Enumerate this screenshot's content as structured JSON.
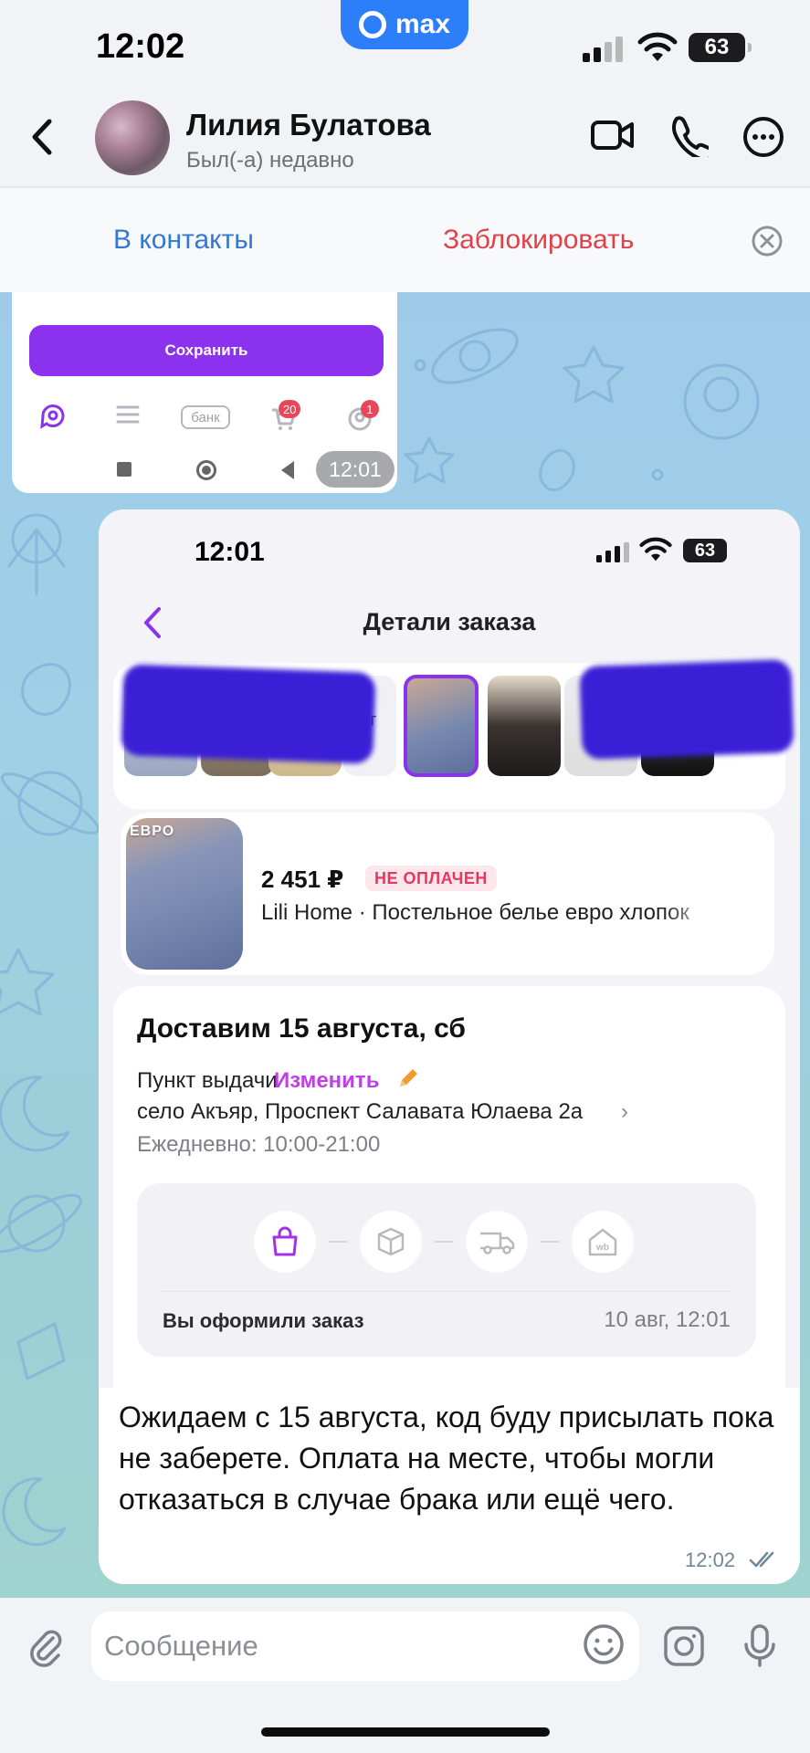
{
  "status_bar": {
    "time": "12:02",
    "battery": "63",
    "app_badge": "max"
  },
  "chat_header": {
    "contact_name": "Лилия Булатова",
    "contact_status": "Был(-а) недавно"
  },
  "contact_actions": {
    "add_label": "В контакты",
    "block_label": "Заблокировать"
  },
  "message_1": {
    "save_button": "Сохранить",
    "nav_bank_label": "банк",
    "cart_badge": "20",
    "profile_badge": "1",
    "time": "12:01"
  },
  "message_2": {
    "screenshot": {
      "status_time": "12:01",
      "battery": "63",
      "title": "Детали заказа",
      "date_chip": {
        "day": "15",
        "month": "авг",
        "weekday": "сб"
      },
      "order_item": {
        "image_tag": "ЕВРО",
        "price": "2 451 ₽",
        "payment_status": "НЕ ОПЛАЧЕН",
        "title": "Lili Home · Постельное белье евро хлопок"
      },
      "delivery": {
        "title": "Доставим 15 августа, сб",
        "pickup_label": "Пункт выдачи",
        "change_label": "Изменить",
        "address": "село Акъяр, Проспект Салавата Юлаева 2а",
        "hours": "Ежедневно: 10:00-21:00"
      },
      "progress": {
        "current_step": 1,
        "total_steps": 4,
        "status_text": "Вы оформили заказ",
        "status_date": "10 авг, 12:01"
      }
    },
    "text": "Ожидаем с 15 августа, код буду присылать пока не заберете. Оплата на месте, чтобы могли отказаться в случае брака или ещё чего.",
    "time": "12:02",
    "read": true
  },
  "input_bar": {
    "placeholder": "Сообщение"
  },
  "colors": {
    "accent_blue": "#3478d4",
    "block_red": "#e0424a",
    "wb_purple": "#8b32ef",
    "change_pink": "#c13ee8",
    "max_blue": "#2d7ff9"
  }
}
